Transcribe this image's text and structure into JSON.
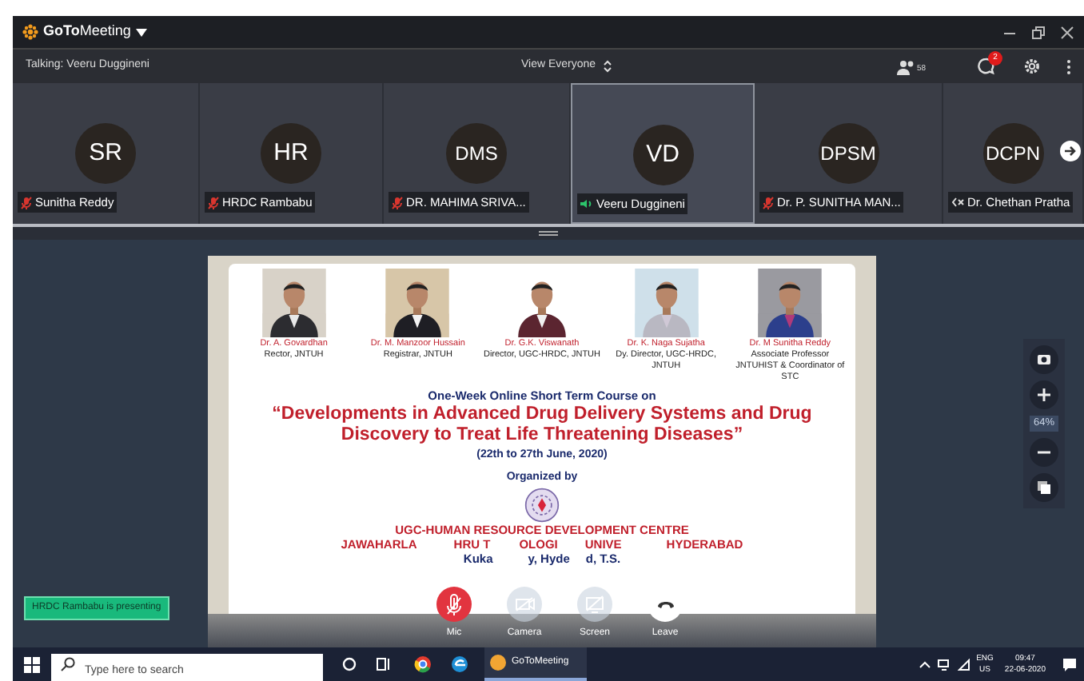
{
  "window": {
    "app_name": "**GoTo**Meeting"
  },
  "toolbar": {
    "talking": "Talking: Veeru Duggineni",
    "view": "View Everyone",
    "attendee_count": "58",
    "chat_badge": "2"
  },
  "participants": [
    {
      "initials": "SR",
      "name": "Sunitha Reddy",
      "kind": "muted",
      "selected": false
    },
    {
      "initials": "HR",
      "name": "HRDC Rambabu",
      "kind": "muted",
      "selected": false
    },
    {
      "initials": "DMS",
      "name": "DR. MAHIMA SRIVA...",
      "kind": "muted",
      "selected": false
    },
    {
      "initials": "VD",
      "name": "Veeru Duggineni",
      "kind": "speaking",
      "selected": true
    },
    {
      "initials": "DPSM",
      "name": "Dr. P. SUNITHA MAN...",
      "kind": "muted",
      "selected": false
    },
    {
      "initials": "DCPN",
      "name": "Dr. Chethan Pratha",
      "kind": "speaker_off",
      "selected": false
    }
  ],
  "slide": {
    "people": [
      {
        "name": "Dr. A. Govardhan",
        "role": "Rector, JNTUH"
      },
      {
        "name": "Dr. M. Manzoor Hussain",
        "role": "Registrar, JNTUH"
      },
      {
        "name": "Dr. G.K. Viswanath",
        "role": "Director, UGC-HRDC, JNTUH"
      },
      {
        "name": "Dr. K. Naga Sujatha",
        "role": "Dy. Director, UGC-HRDC, JNTUH"
      },
      {
        "name": "Dr. M Sunitha Reddy",
        "role": "Associate Professor JNTUHIST & Coordinator of STC"
      }
    ],
    "heading": "One-Week Online Short Term Course on",
    "title": "“Developments in Advanced Drug Delivery Systems and Drug Discovery to Treat Life Threatening Diseases”",
    "dates": "(22th to 27th June, 2020)",
    "organized_by": "Organized by",
    "org_line": "UGC-HUMAN RESOURCE DEVELOPMENT CENTRE",
    "university_fragments": [
      "JAWAHARLA",
      "HRU T",
      "OLOGI",
      "UNIVE",
      "HYDERABAD"
    ],
    "city_fragments": [
      "Kuka",
      "y, Hyde",
      "d, T.S."
    ]
  },
  "presenting": "HRDC Rambabu is presenting",
  "zoom_level": "64%",
  "controls": [
    {
      "kind": "mic",
      "label": "Mic",
      "muted": true
    },
    {
      "kind": "camera",
      "label": "Camera",
      "disabled": true
    },
    {
      "kind": "screen",
      "label": "Screen",
      "disabled": true
    },
    {
      "kind": "leave",
      "label": "Leave"
    }
  ],
  "taskbar": {
    "search_placeholder": "Type here to search",
    "app": "GoToMeeting",
    "language": "ENG",
    "region": "US",
    "time": "09:47",
    "date": "22-06-2020"
  }
}
